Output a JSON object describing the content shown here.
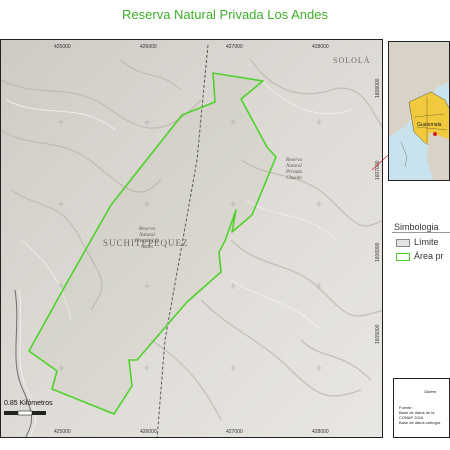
{
  "map_title": "Reserva Natural Privada Los Andes",
  "ticks_top": [
    "425000",
    "426000",
    "427000",
    "428000"
  ],
  "ticks_bottom": [
    "425000",
    "426000",
    "427000",
    "428000"
  ],
  "ticks_right": [
    "1608000",
    "1607000",
    "1606000",
    "1605000"
  ],
  "region_labels": {
    "upper_right": "SOLOLÁ",
    "center": "SUCHITEPÉQUEZ"
  },
  "reserve_labels": {
    "main": [
      "Reserva",
      "Natural",
      "Privada Los",
      "Andes"
    ],
    "neighbor": [
      "Reserva",
      "Natural",
      "Privada",
      "Chusita"
    ]
  },
  "scale": {
    "label": "0.85 Kilómetros"
  },
  "inset_label": "Guatemala",
  "legend": {
    "title": "Simbologia",
    "items": [
      {
        "label": "Límite",
        "fill": "#e3e3e3",
        "stroke": "#888888"
      },
      {
        "label": "Área pr",
        "fill": "#ffffff",
        "stroke": "#4fd12b"
      }
    ]
  },
  "info": {
    "heading": "Sistem",
    "lines": [
      "Fuente:",
      "Base de datos de la",
      "CONAP 2016",
      "Base de datos cartogra"
    ]
  },
  "colors": {
    "boundary": "#4fd12b",
    "title": "#3fae2a",
    "terrain": "#dcdad6",
    "road": "#666666"
  }
}
